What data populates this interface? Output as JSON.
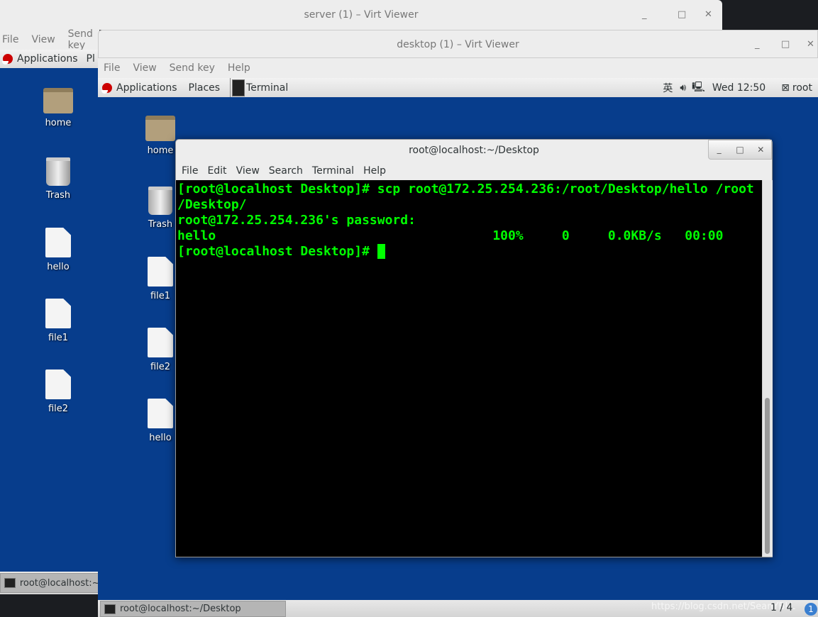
{
  "back_window": {
    "title": "server (1) – Virt Viewer",
    "menu": [
      "File",
      "View",
      "Send key"
    ],
    "panel": {
      "applications": "Applications",
      "places_partial": "Pl"
    },
    "desktop_icons": [
      {
        "label": "home",
        "icon": "home-folder-icon"
      },
      {
        "label": "Trash",
        "icon": "trash-icon"
      },
      {
        "label": "hello",
        "icon": "file-icon"
      },
      {
        "label": "file1",
        "icon": "file-icon"
      },
      {
        "label": "file2",
        "icon": "file-icon"
      }
    ],
    "taskbar_item": "root@localhost:~"
  },
  "front_window": {
    "title": "desktop (1) – Virt Viewer",
    "menu": [
      "File",
      "View",
      "Send key",
      "Help"
    ],
    "panel": {
      "applications": "Applications",
      "places": "Places",
      "active_app": "Terminal",
      "input_method": "英",
      "clock": "Wed 12:50",
      "user": "root"
    },
    "desktop_icons": [
      {
        "label": "home",
        "icon": "home-folder-icon"
      },
      {
        "label": "Trash",
        "icon": "trash-icon"
      },
      {
        "label": "file1",
        "icon": "file-icon"
      },
      {
        "label": "file2",
        "icon": "file-icon"
      },
      {
        "label": "hello",
        "icon": "file-icon"
      }
    ],
    "taskbar_item": "root@localhost:~/Desktop",
    "workspace": "1 / 4",
    "notification_count": "1"
  },
  "terminal": {
    "title": "root@localhost:~/Desktop",
    "menu": [
      "File",
      "Edit",
      "View",
      "Search",
      "Terminal",
      "Help"
    ],
    "lines": [
      "[root@localhost Desktop]# scp root@172.25.254.236:/root/Desktop/hello /root",
      "/Desktop/",
      "root@172.25.254.236's password: ",
      "hello                                    100%     0     0.0KB/s   00:00",
      "[root@localhost Desktop]# "
    ],
    "text_color": "#00ff00"
  },
  "watermark": "https://blog.csdn.net/SeanYBLL"
}
